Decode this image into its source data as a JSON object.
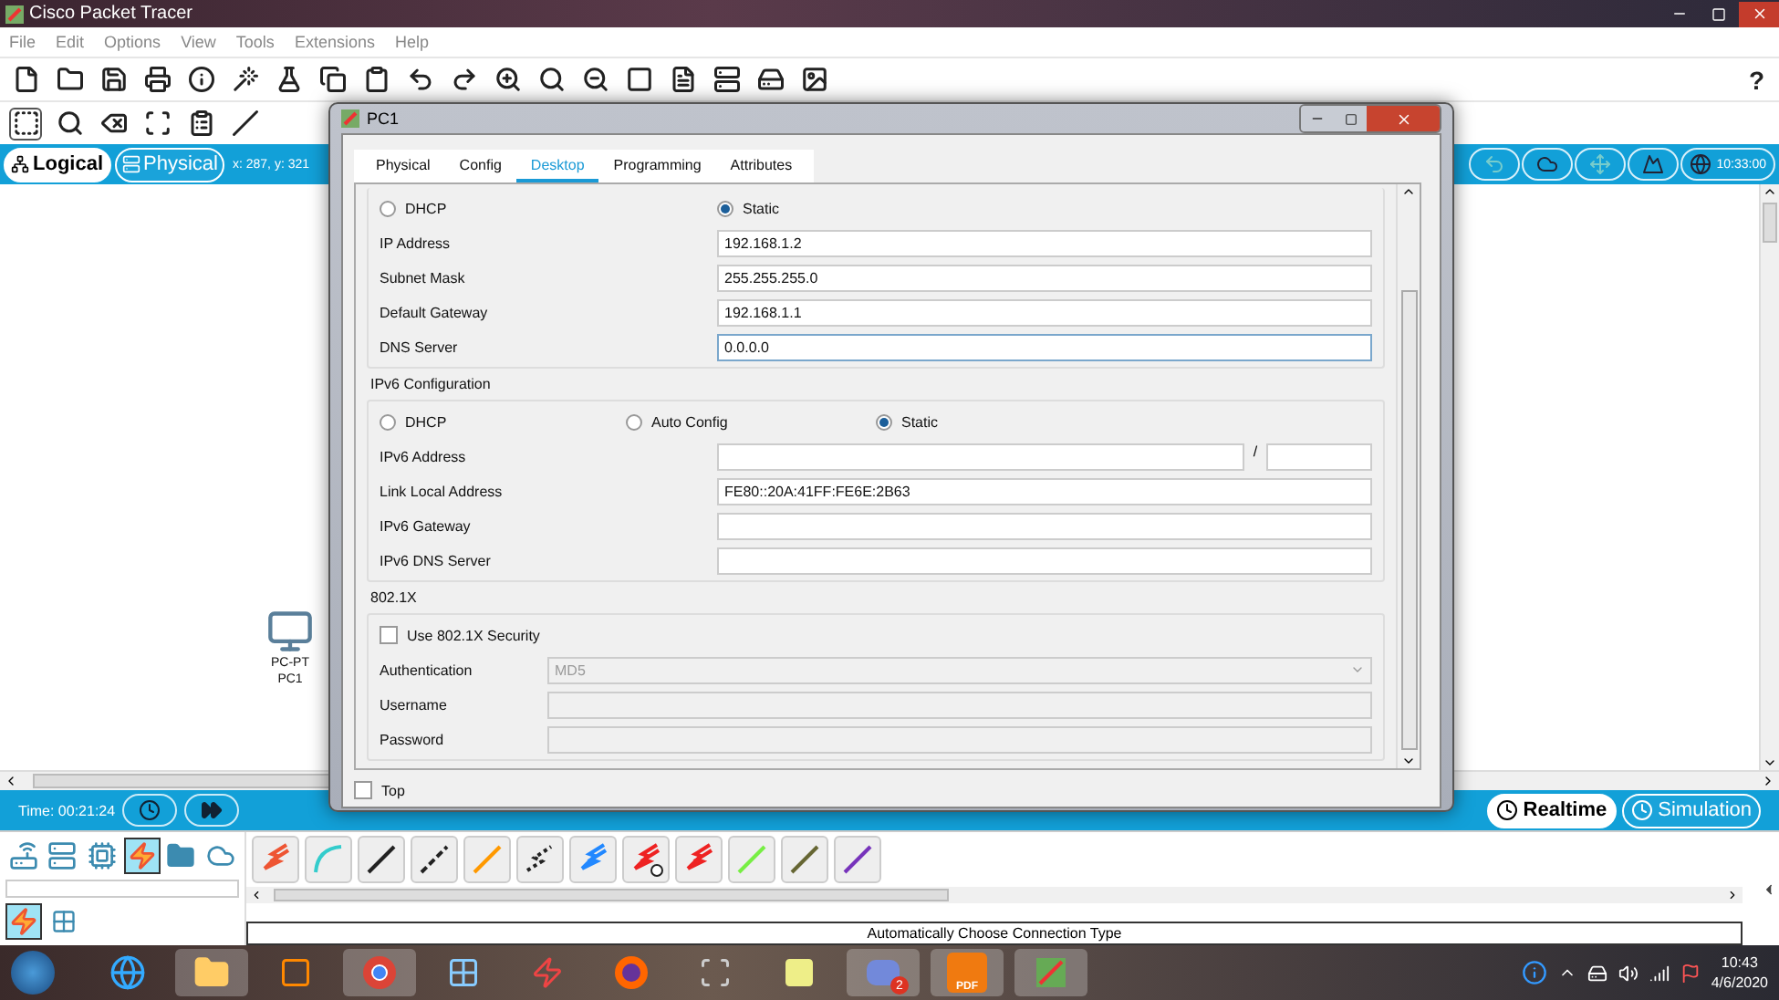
{
  "app_window": {
    "title": "Cisco Packet Tracer"
  },
  "menu": [
    "File",
    "Edit",
    "Options",
    "View",
    "Tools",
    "Extensions",
    "Help"
  ],
  "help_button": "?",
  "workspace_tabs": [
    {
      "label": "Logical",
      "selected": true
    },
    {
      "label": "Physical",
      "selected": false
    }
  ],
  "coordinates": "x: 287, y: 321",
  "clock": "10:33:00",
  "canvas_device": {
    "type": "PC-PT",
    "name": "PC1"
  },
  "sim_time": "Time: 00:21:24",
  "modes": [
    {
      "label": "Realtime",
      "selected": true
    },
    {
      "label": "Simulation",
      "selected": false
    }
  ],
  "connection_hint": "Automatically Choose Connection Type",
  "dialog": {
    "title": "PC1",
    "tabs": [
      {
        "label": "Physical",
        "selected": false
      },
      {
        "label": "Config",
        "selected": false
      },
      {
        "label": "Desktop",
        "selected": true
      },
      {
        "label": "Programming",
        "selected": false
      },
      {
        "label": "Attributes",
        "selected": false
      }
    ],
    "ipv4": {
      "modes": [
        {
          "label": "DHCP",
          "selected": false
        },
        {
          "label": "Static",
          "selected": true
        }
      ],
      "fields": [
        {
          "label": "IP Address",
          "value": "192.168.1.2",
          "focused": false
        },
        {
          "label": "Subnet Mask",
          "value": "255.255.255.0",
          "focused": false
        },
        {
          "label": "Default Gateway",
          "value": "192.168.1.1",
          "focused": false
        },
        {
          "label": "DNS Server",
          "value": "0.0.0.0",
          "focused": true
        }
      ]
    },
    "ipv6": {
      "title": "IPv6 Configuration",
      "modes": [
        {
          "label": "DHCP",
          "selected": false
        },
        {
          "label": "Auto Config",
          "selected": false
        },
        {
          "label": "Static",
          "selected": true
        }
      ],
      "fields": [
        {
          "label": "IPv6 Address",
          "kind": "prefixed",
          "separator": "/"
        },
        {
          "label": "Link Local Address",
          "kind": "plain",
          "value": "FE80::20A:41FF:FE6E:2B63"
        },
        {
          "label": "IPv6 Gateway",
          "kind": "plain"
        },
        {
          "label": "IPv6 DNS Server",
          "kind": "plain"
        }
      ]
    },
    "dot1x": {
      "title": "802.1X",
      "security": {
        "label": "Use 802.1X Security",
        "checked": false
      },
      "fields": [
        {
          "label": "Authentication",
          "kind": "select",
          "value": "MD5",
          "disabled": true
        },
        {
          "label": "Username",
          "kind": "text",
          "disabled": true
        },
        {
          "label": "Password",
          "kind": "text",
          "disabled": true
        }
      ]
    },
    "top": {
      "label": "Top",
      "checked": false
    }
  },
  "taskbar": {
    "discord_badge": "2",
    "pdf_label": "PDF",
    "time": "10:43",
    "date": "4/6/2020"
  }
}
